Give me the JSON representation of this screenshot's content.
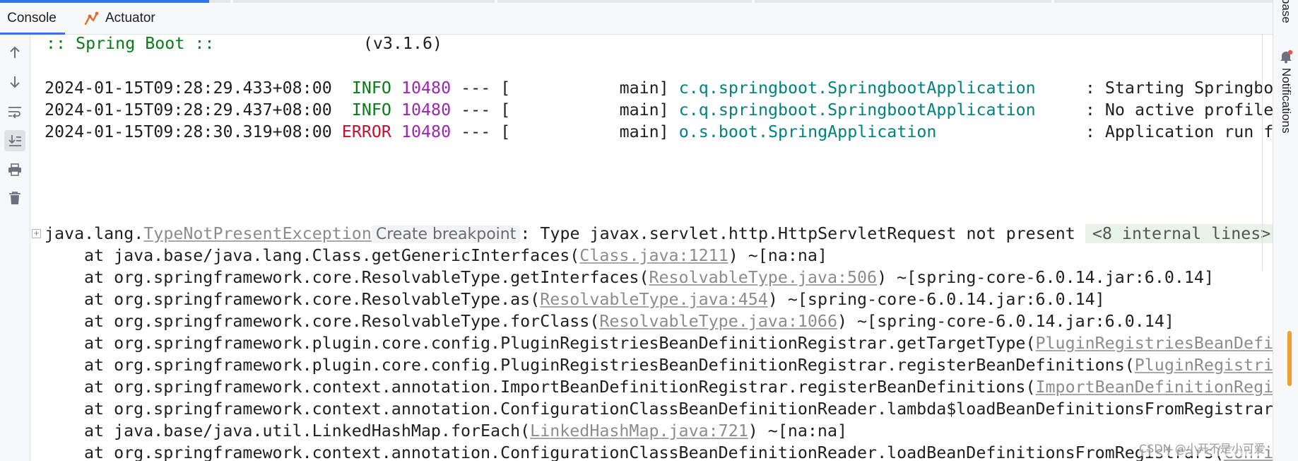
{
  "tabs": [
    {
      "label": "Console",
      "active": true
    },
    {
      "label": "Actuator",
      "icon": "actuator-icon"
    }
  ],
  "toolbar": {
    "icons": [
      "arrow-up-icon",
      "arrow-down-icon",
      "soft-wrap-icon",
      "scroll-to-end-icon",
      "print-icon",
      "trash-icon"
    ]
  },
  "console": {
    "banner_label": ":: Spring Boot ::",
    "banner_version": "(v3.1.6)",
    "log_lines": [
      {
        "timestamp": "2024-01-15T09:28:29.433+08:00",
        "level": "INFO",
        "pid": "10480",
        "sep": "--- [",
        "thread": "main]",
        "logger": "c.q.springboot.SpringbootApplication",
        "message": ": Starting Springboot"
      },
      {
        "timestamp": "2024-01-15T09:28:29.437+08:00",
        "level": "INFO",
        "pid": "10480",
        "sep": "--- [",
        "thread": "main]",
        "logger": "c.q.springboot.SpringbootApplication",
        "message": ": No active profile"
      },
      {
        "timestamp": "2024-01-15T09:28:30.319+08:00",
        "level": "ERROR",
        "pid": "10480",
        "sep": "--- [",
        "thread": "main]",
        "logger": "o.s.boot.SpringApplication",
        "message": ": Application run fa"
      }
    ],
    "exception": {
      "prefix": "java.lang.",
      "class_link": "TypeNotPresentException",
      "breakpoint_hint": "Create breakpoint",
      "message": ": Type javax.servlet.http.HttpServletRequest not present",
      "folded": "<8 internal lines>"
    },
    "stack": [
      {
        "text": "at java.base/java.lang.Class.getGenericInterfaces(",
        "link": "Class.java:1211",
        "suffix": ") ~[na:na]"
      },
      {
        "text": "at org.springframework.core.ResolvableType.getInterfaces(",
        "link": "ResolvableType.java:506",
        "suffix": ") ~[spring-core-6.0.14.jar:6.0.14]"
      },
      {
        "text": "at org.springframework.core.ResolvableType.as(",
        "link": "ResolvableType.java:454",
        "suffix": ") ~[spring-core-6.0.14.jar:6.0.14]"
      },
      {
        "text": "at org.springframework.core.ResolvableType.forClass(",
        "link": "ResolvableType.java:1066",
        "suffix": ") ~[spring-core-6.0.14.jar:6.0.14]"
      },
      {
        "text": "at org.springframework.plugin.core.config.PluginRegistriesBeanDefinitionRegistrar.getTargetType(",
        "link": "PluginRegistriesBeanDefin",
        "suffix": ""
      },
      {
        "text": "at org.springframework.plugin.core.config.PluginRegistriesBeanDefinitionRegistrar.registerBeanDefinitions(",
        "link": "PluginRegistrie",
        "suffix": ""
      },
      {
        "text": "at org.springframework.context.annotation.ImportBeanDefinitionRegistrar.registerBeanDefinitions(",
        "link": "ImportBeanDefinitionRegis",
        "suffix": ""
      },
      {
        "text": "at org.springframework.context.annotation.ConfigurationClassBeanDefinitionReader.lambda$loadBeanDefinitionsFromRegistrars",
        "link": "",
        "suffix": ""
      },
      {
        "text": "at java.base/java.util.LinkedHashMap.forEach(",
        "link": "LinkedHashMap.java:721",
        "suffix": ") ~[na:na]"
      },
      {
        "text": "at org.springframework.context.annotation.ConfigurationClassBeanDefinitionReader.loadBeanDefinitionsFromRegistrars(",
        "link": "Confi",
        "suffix": ""
      }
    ]
  },
  "right_panel": {
    "top_label": "base",
    "notifications_label": "Notifications"
  },
  "watermark": "CSDN @小开不是小可爱",
  "colors": {
    "accent": "#3574f0",
    "info": "#067d17",
    "error": "#c8102e",
    "pid": "#9c27b0",
    "logger": "#00827f"
  }
}
